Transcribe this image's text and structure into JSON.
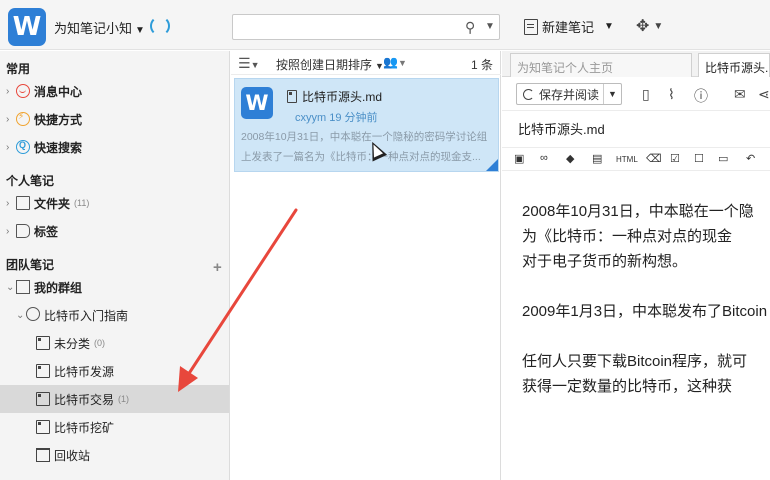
{
  "topbar": {
    "logo_letter": "W",
    "account_name": "为知笔记小知",
    "search_placeholder": "",
    "new_note_label": "新建笔记"
  },
  "sidebar": {
    "common_title": "常用",
    "common_items": [
      {
        "label": "消息中心",
        "icon": "message-icon"
      },
      {
        "label": "快捷方式",
        "icon": "shortcut-icon"
      },
      {
        "label": "快速搜索",
        "icon": "quick-search-icon"
      }
    ],
    "personal_title": "个人笔记",
    "personal_items": [
      {
        "label": "文件夹",
        "count": "(11)",
        "icon": "folder-icon"
      },
      {
        "label": "标签",
        "icon": "tag-icon"
      }
    ],
    "team_title": "团队笔记",
    "my_group_label": "我的群组",
    "group_name": "比特币入门指南",
    "folders": [
      {
        "label": "未分类",
        "count": "(0)"
      },
      {
        "label": "比特币发源",
        "count": ""
      },
      {
        "label": "比特币交易",
        "count": "(1)",
        "selected": true
      },
      {
        "label": "比特币挖矿",
        "count": ""
      },
      {
        "label": "回收站",
        "count": ""
      }
    ]
  },
  "notelist": {
    "sort_label": "按照创建日期排序",
    "count_label": "1 条",
    "note": {
      "title": "比特币源头.md",
      "meta": "cxyym  19 分钟前",
      "snippet_line1": "2008年10月31日，中本聪在一个隐秘的密码学讨论组",
      "snippet_line2": "上发表了一篇名为《比特币：一种点对点的现金支..."
    }
  },
  "editor": {
    "tab_home": "为知笔记个人主页",
    "tab_note": "比特币源头.md",
    "save_read_label": "保存并阅读",
    "note_title": "比特币源头.md",
    "fmt_html": "HTML",
    "paragraphs": [
      {
        "line1": "2008年10月31日，中本聪在一个隐",
        "line2": "为《比特币：一种点对点的现金",
        "line3": "对于电子货币的新构想。"
      },
      {
        "line1": "2009年1月3日，中本聪发布了Bitcoin"
      },
      {
        "line1": "任何人只要下载Bitcoin程序，就可",
        "line2": "获得一定数量的比特币，这种获"
      }
    ]
  },
  "colors": {
    "brand_blue": "#2e7fd6",
    "selected_note_bg": "#cfe6f7",
    "annotation_arrow": "#e8473c"
  }
}
